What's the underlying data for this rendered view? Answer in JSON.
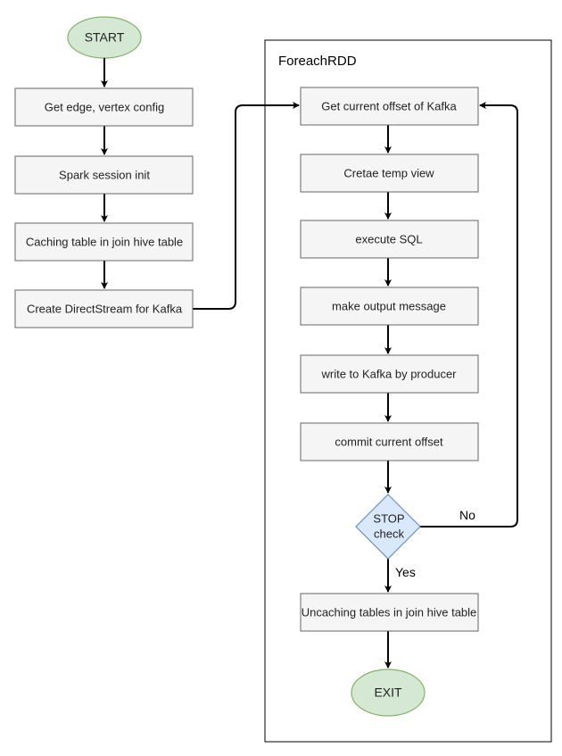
{
  "colors": {
    "terminal_fill": "#d5e8d4",
    "terminal_stroke": "#82b366",
    "decision_fill": "#dae8fc",
    "decision_stroke": "#6c8ebf",
    "process_fill": "#f5f5f5"
  },
  "start": "START",
  "left_steps": [
    "Get edge, vertex config",
    "Spark session init",
    "Caching table in join hive table",
    "Create DirectStream for Kafka"
  ],
  "container": {
    "title": "ForeachRDD"
  },
  "loop_steps": [
    "Get current offset of Kafka",
    "Cretae temp view",
    "execute SQL",
    "make output message",
    "write to Kafka by producer",
    "commit current offset"
  ],
  "decision": {
    "line1": "STOP",
    "line2": "check",
    "no_label": "No",
    "yes_label": "Yes"
  },
  "after_step": "Uncaching tables in join hive table",
  "exit": "EXIT"
}
